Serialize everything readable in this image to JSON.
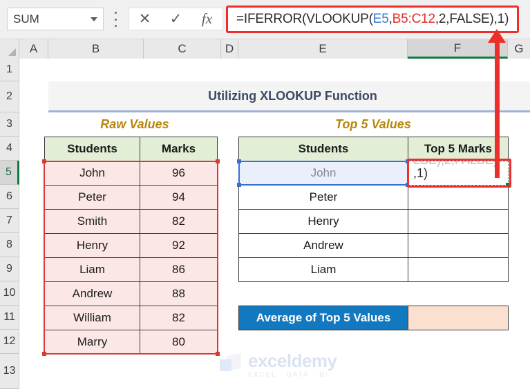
{
  "formula_bar": {
    "name_box_value": "SUM",
    "cancel_icon": "✕",
    "enter_icon": "✓",
    "function_icon": "fx",
    "formula_parts": {
      "p1": "=IFERROR(VLOOKUP(",
      "ref1": "E5",
      "p2": ",",
      "ref2": "B5:C12",
      "p3": ",2,FALSE),1)"
    },
    "formula_full": "=IFERROR(VLOOKUP(E5,B5:C12,2,FALSE),1)"
  },
  "grid": {
    "columns": [
      "A",
      "B",
      "C",
      "D",
      "E",
      "F",
      "G"
    ],
    "active_column": "F",
    "rows": [
      "1",
      "2",
      "3",
      "4",
      "5",
      "6",
      "7",
      "8",
      "9",
      "10",
      "11",
      "12",
      "13"
    ],
    "active_row": "5"
  },
  "sheet": {
    "title": "Utilizing XLOOKUP Function",
    "section_left": "Raw Values",
    "section_right": "Top 5 Values",
    "raw_table": {
      "headers": [
        "Students",
        "Marks"
      ],
      "rows": [
        [
          "John",
          "96"
        ],
        [
          "Peter",
          "94"
        ],
        [
          "Smith",
          "82"
        ],
        [
          "Henry",
          "92"
        ],
        [
          "Liam",
          "86"
        ],
        [
          "Andrew",
          "88"
        ],
        [
          "William",
          "82"
        ],
        [
          "Marry",
          "80"
        ]
      ]
    },
    "top5_table": {
      "headers": [
        "Students",
        "Top 5 Marks"
      ],
      "rows": [
        [
          "John",
          ""
        ],
        [
          "Peter",
          ""
        ],
        [
          "Henry",
          ""
        ],
        [
          "Andrew",
          ""
        ],
        [
          "Liam",
          ""
        ]
      ]
    },
    "active_cell_text": ",1)",
    "active_cell_ghost": "LSE),2,FALSE)",
    "average_label": "Average of Top 5 Values",
    "average_value": ""
  },
  "watermark": {
    "main": "exceldemy",
    "sub": "EXCEL - DATA - BI"
  },
  "colors": {
    "accent_red": "#ec2f2b",
    "ref_blue": "#3a6fd0",
    "header_green": "#e2eed5",
    "raw_pink": "#fbe8e6",
    "avg_blue": "#1279c0",
    "avg_peach": "#fce0cf",
    "title_navy": "#3c4a63",
    "section_gold": "#b8860b",
    "active_green": "#0e7c42"
  }
}
